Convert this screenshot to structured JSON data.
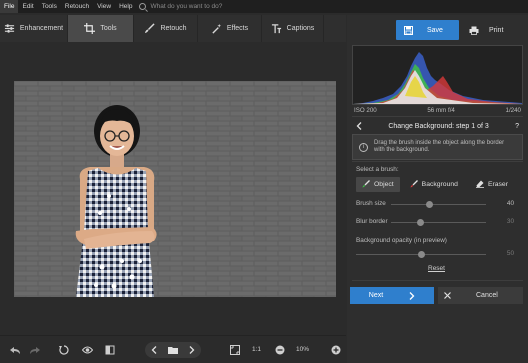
{
  "menu": {
    "items": [
      "File",
      "Edit",
      "Tools",
      "Retouch",
      "View",
      "Help"
    ],
    "search_placeholder": "What do you want to do?"
  },
  "tabs": {
    "enhancement": "Enhancement",
    "tools": "Tools",
    "retouch": "Retouch",
    "effects": "Effects",
    "captions": "Captions"
  },
  "actions": {
    "save": "Save",
    "print": "Print"
  },
  "exif": {
    "iso": "ISO 200",
    "lens": "56 mm f/4",
    "shutter": "1/240"
  },
  "wizard": {
    "title": "Change Background: step 1 of 3",
    "help": "?",
    "hint": "Drag the brush inside the object along the border with the background.",
    "select_brush_label": "Select a brush:",
    "brushes": [
      "Object",
      "Background",
      "Eraser"
    ],
    "brush_size_label": "Brush size",
    "brush_size_value": "40",
    "blur_border_label": "Blur border",
    "blur_border_value": "30",
    "bg_opacity_label": "Background opacity (in preview)",
    "bg_opacity_value": "50",
    "reset": "Reset",
    "next": "Next",
    "cancel": "Cancel"
  },
  "bottom": {
    "zoom_ratio": "1:1",
    "zoom_percent": "10%"
  },
  "colors": {
    "accent": "#2f7fcd",
    "background": "#2b2b2b",
    "panel": "#2e2e2e"
  },
  "values": {
    "brush_size_fraction": 0.4,
    "blur_border_fraction": 0.3,
    "bg_opacity_fraction": 0.5
  }
}
